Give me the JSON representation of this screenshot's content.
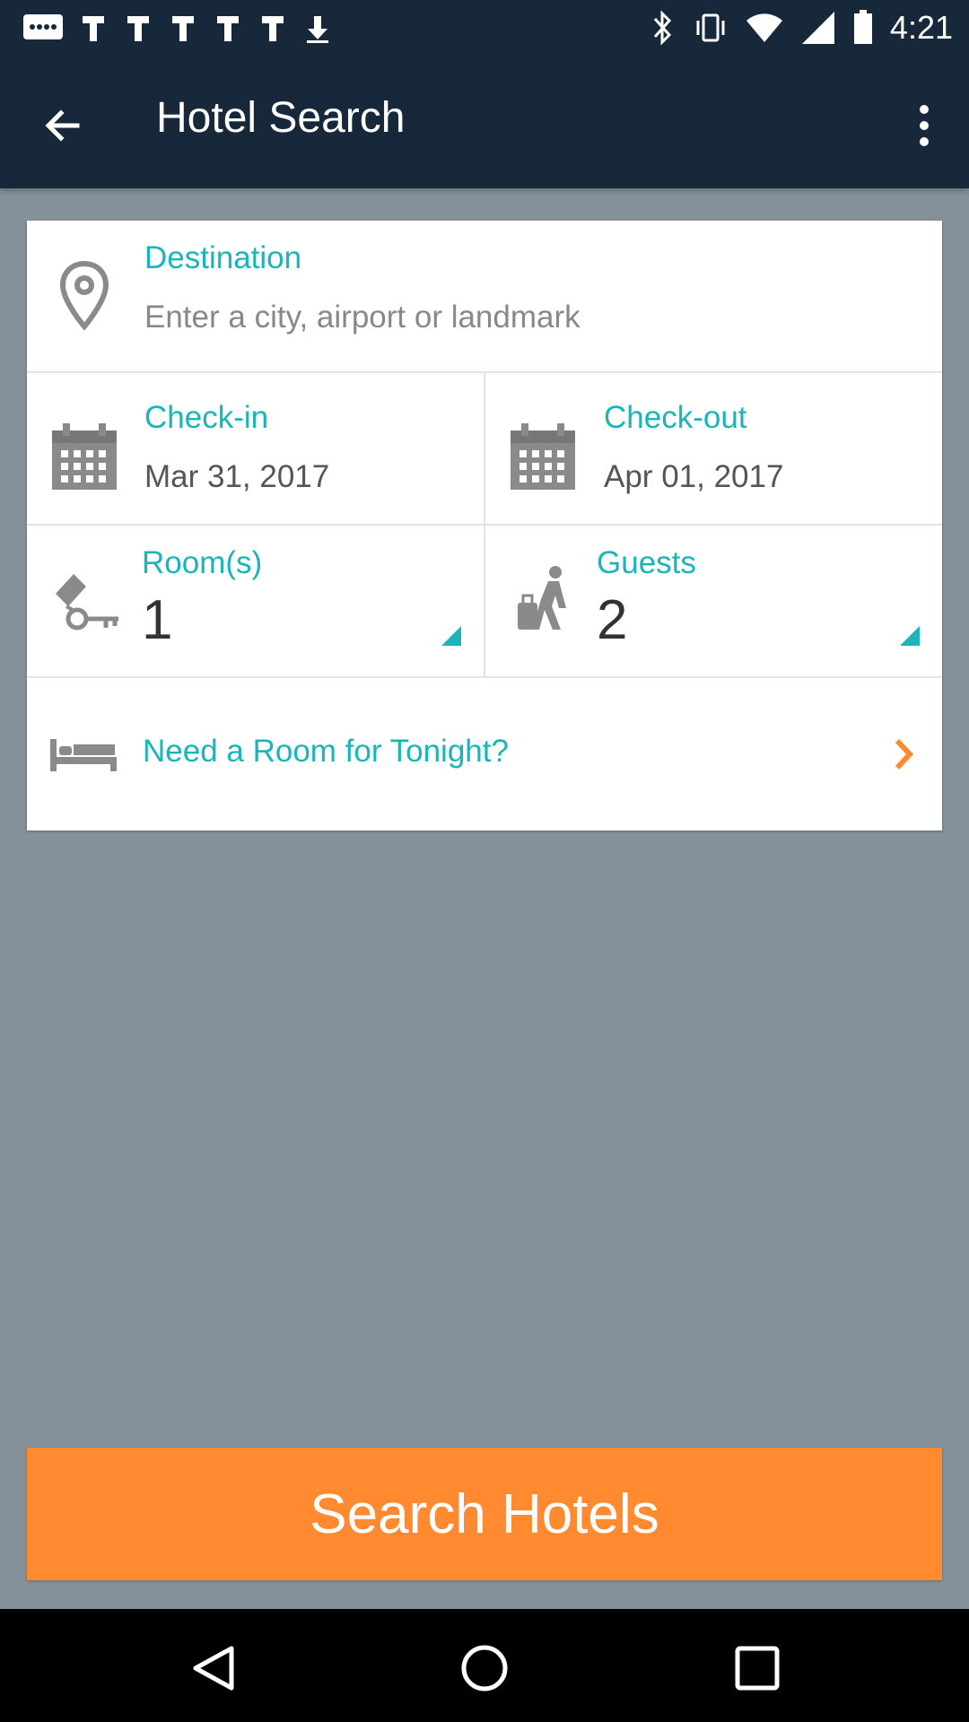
{
  "status_bar": {
    "time": "4:21"
  },
  "app_bar": {
    "title": "Hotel Search"
  },
  "destination": {
    "label": "Destination",
    "placeholder": "Enter a city, airport or landmark"
  },
  "check_in": {
    "label": "Check-in",
    "value": "Mar 31, 2017"
  },
  "check_out": {
    "label": "Check-out",
    "value": "Apr 01, 2017"
  },
  "rooms": {
    "label": "Room(s)",
    "value": "1"
  },
  "guests": {
    "label": "Guests",
    "value": "2"
  },
  "tonight": {
    "label": "Need a Room for Tonight?"
  },
  "search_button": {
    "label": "Search Hotels"
  },
  "colors": {
    "accent": "#19b5b8",
    "orange": "#ff8a2f",
    "appbar": "#17283a",
    "background": "#84919a"
  }
}
